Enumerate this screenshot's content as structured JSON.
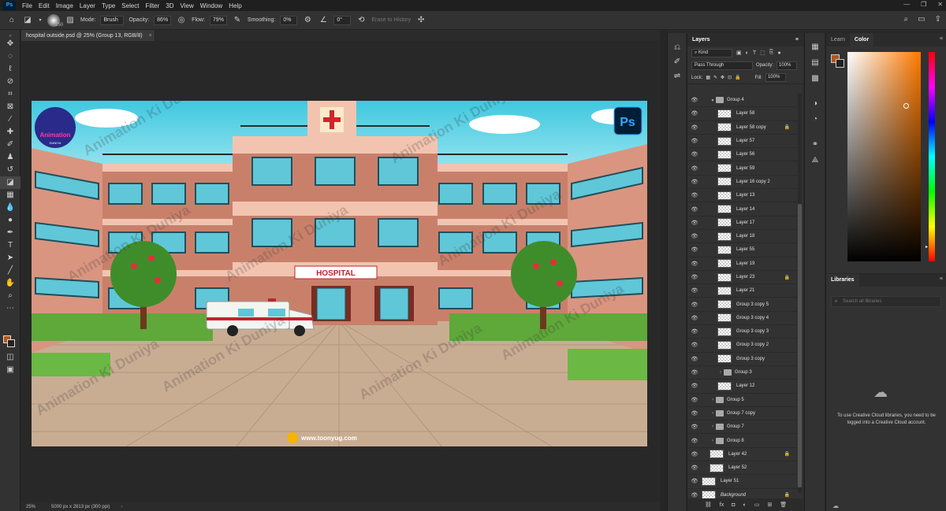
{
  "menubar": {
    "items": [
      "File",
      "Edit",
      "Image",
      "Layer",
      "Type",
      "Select",
      "Filter",
      "3D",
      "View",
      "Window",
      "Help"
    ]
  },
  "options": {
    "brush_size": "250",
    "mode_label": "Mode:",
    "mode_value": "Brush",
    "opacity_label": "Opacity:",
    "opacity_value": "86%",
    "flow_label": "Flow:",
    "flow_value": "79%",
    "smoothing_label": "Smoothing:",
    "smoothing_value": "0%",
    "angle_value": "0°",
    "erase_history": "Erase to History"
  },
  "document": {
    "tab_title": "hospital outside.psd @ 25% (Group 13, RGB/8)",
    "zoom": "25%",
    "info": "5000 px x 2813 px (300 ppi)"
  },
  "canvas_text": {
    "sign": "HOSPITAL",
    "logo": "Animation",
    "logo_sub": "DUNIYA",
    "website": "www.toonyug.com",
    "watermark": "Animation Ki Duniya",
    "ps_badge": "Ps"
  },
  "layers_panel": {
    "title": "Layers",
    "kind_label": "Kind",
    "blend_mode": "Pass Through",
    "opacity_label": "Opacity:",
    "opacity_value": "100%",
    "lock_label": "Lock:",
    "fill_label": "Fill:",
    "fill_value": "100%",
    "layers": [
      {
        "name": "Group 4",
        "type": "group",
        "indent": 1,
        "expanded": true,
        "lock": false
      },
      {
        "name": "Layer 58",
        "type": "layer",
        "indent": 2,
        "lock": false
      },
      {
        "name": "Layer 58 copy",
        "type": "layer",
        "indent": 2,
        "lock": true
      },
      {
        "name": "Layer 57",
        "type": "layer",
        "indent": 2,
        "lock": false
      },
      {
        "name": "Layer 56",
        "type": "layer",
        "indent": 2,
        "lock": false
      },
      {
        "name": "Layer 59",
        "type": "layer",
        "indent": 2,
        "lock": false
      },
      {
        "name": "Layer 16 copy 2",
        "type": "layer",
        "indent": 2,
        "lock": false
      },
      {
        "name": "Layer 13",
        "type": "layer",
        "indent": 2,
        "lock": false
      },
      {
        "name": "Layer 14",
        "type": "layer",
        "indent": 2,
        "lock": false
      },
      {
        "name": "Layer 17",
        "type": "layer",
        "indent": 2,
        "lock": false
      },
      {
        "name": "Layer 18",
        "type": "layer",
        "indent": 2,
        "lock": false
      },
      {
        "name": "Layer 55",
        "type": "layer",
        "indent": 2,
        "lock": false
      },
      {
        "name": "Layer 19",
        "type": "layer",
        "indent": 2,
        "lock": false
      },
      {
        "name": "Layer 23",
        "type": "layer",
        "indent": 2,
        "lock": true
      },
      {
        "name": "Layer 21",
        "type": "layer",
        "indent": 2,
        "lock": false
      },
      {
        "name": "Group 3 copy 5",
        "type": "layer",
        "indent": 2,
        "lock": false
      },
      {
        "name": "Group 3 copy 4",
        "type": "layer",
        "indent": 2,
        "lock": false
      },
      {
        "name": "Group 3 copy 3",
        "type": "layer",
        "indent": 2,
        "lock": false
      },
      {
        "name": "Group 3 copy 2",
        "type": "layer",
        "indent": 2,
        "lock": false
      },
      {
        "name": "Group 3 copy",
        "type": "layer",
        "indent": 2,
        "lock": false
      },
      {
        "name": "Group 3",
        "type": "group",
        "indent": 2,
        "expanded": false,
        "lock": false
      },
      {
        "name": "Layer 12",
        "type": "layer",
        "indent": 2,
        "lock": false
      },
      {
        "name": "Group 5",
        "type": "group",
        "indent": 1,
        "expanded": false,
        "lock": false
      },
      {
        "name": "Group 7 copy",
        "type": "group",
        "indent": 1,
        "expanded": false,
        "lock": false
      },
      {
        "name": "Group 7",
        "type": "group",
        "indent": 1,
        "expanded": false,
        "lock": false
      },
      {
        "name": "Group 8",
        "type": "group",
        "indent": 1,
        "expanded": false,
        "lock": false
      },
      {
        "name": "Layer 42",
        "type": "layer",
        "indent": 1,
        "lock": true
      },
      {
        "name": "Layer 52",
        "type": "layer",
        "indent": 1,
        "lock": false
      },
      {
        "name": "Layer 51",
        "type": "layer",
        "indent": 0,
        "lock": false
      },
      {
        "name": "Background",
        "type": "layer",
        "indent": 0,
        "lock": true,
        "italic": true
      }
    ]
  },
  "color_panel": {
    "tab_learn": "Learn",
    "tab_color": "Color",
    "foreground": "#b5561c",
    "background": "#222222"
  },
  "libraries_panel": {
    "title": "Libraries",
    "search_placeholder": "Search all libraries",
    "message": "To use Creative Cloud libraries, you need to be logged into a Creative Cloud account."
  }
}
